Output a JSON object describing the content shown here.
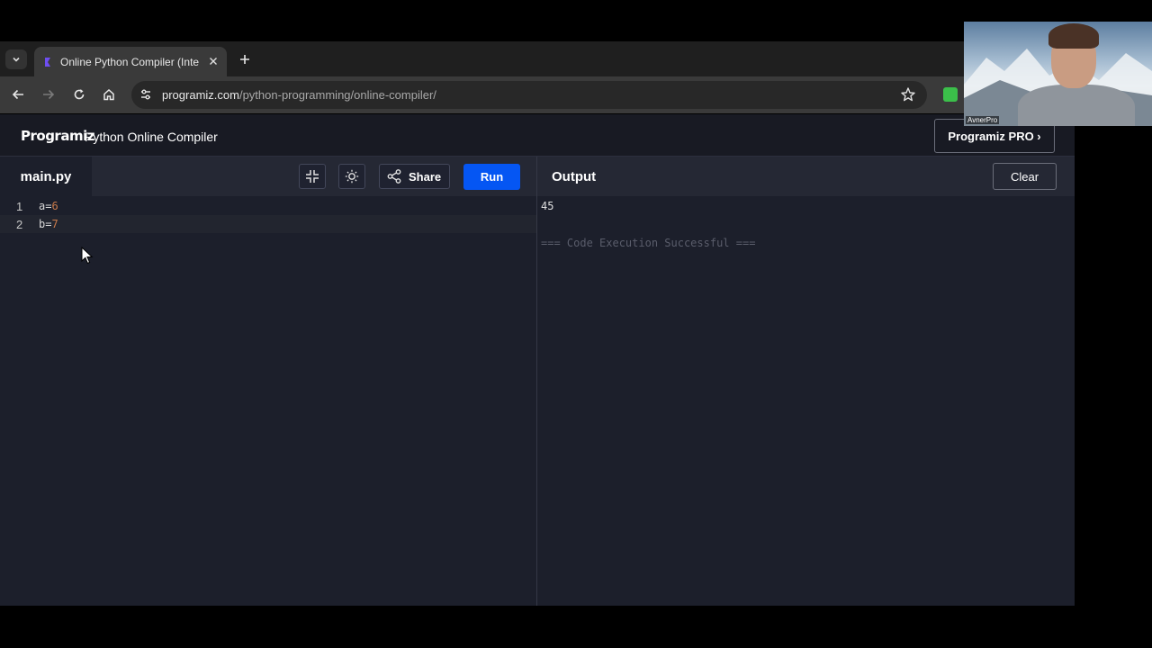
{
  "browser": {
    "tab_title": "Online Python Compiler (Interpreter)",
    "url_domain": "programiz.com",
    "url_path": "/python-programming/online-compiler/"
  },
  "site": {
    "logo": "Programiz",
    "title": "Python Online Compiler",
    "pro_button": "Programiz PRO ›"
  },
  "editor": {
    "filename": "main.py",
    "share_label": "Share",
    "run_label": "Run",
    "lines": [
      {
        "number": "1",
        "var": "a=",
        "value": "6"
      },
      {
        "number": "2",
        "var": "b=",
        "value": "7"
      }
    ]
  },
  "output": {
    "title": "Output",
    "clear_label": "Clear",
    "result": "45",
    "status": "=== Code Execution Successful ==="
  },
  "webcam": {
    "label": "AvnerPro"
  },
  "colors": {
    "run_button": "#0556f3",
    "page_background": "#1c1f2b",
    "number_literal": "#c97a4a"
  }
}
